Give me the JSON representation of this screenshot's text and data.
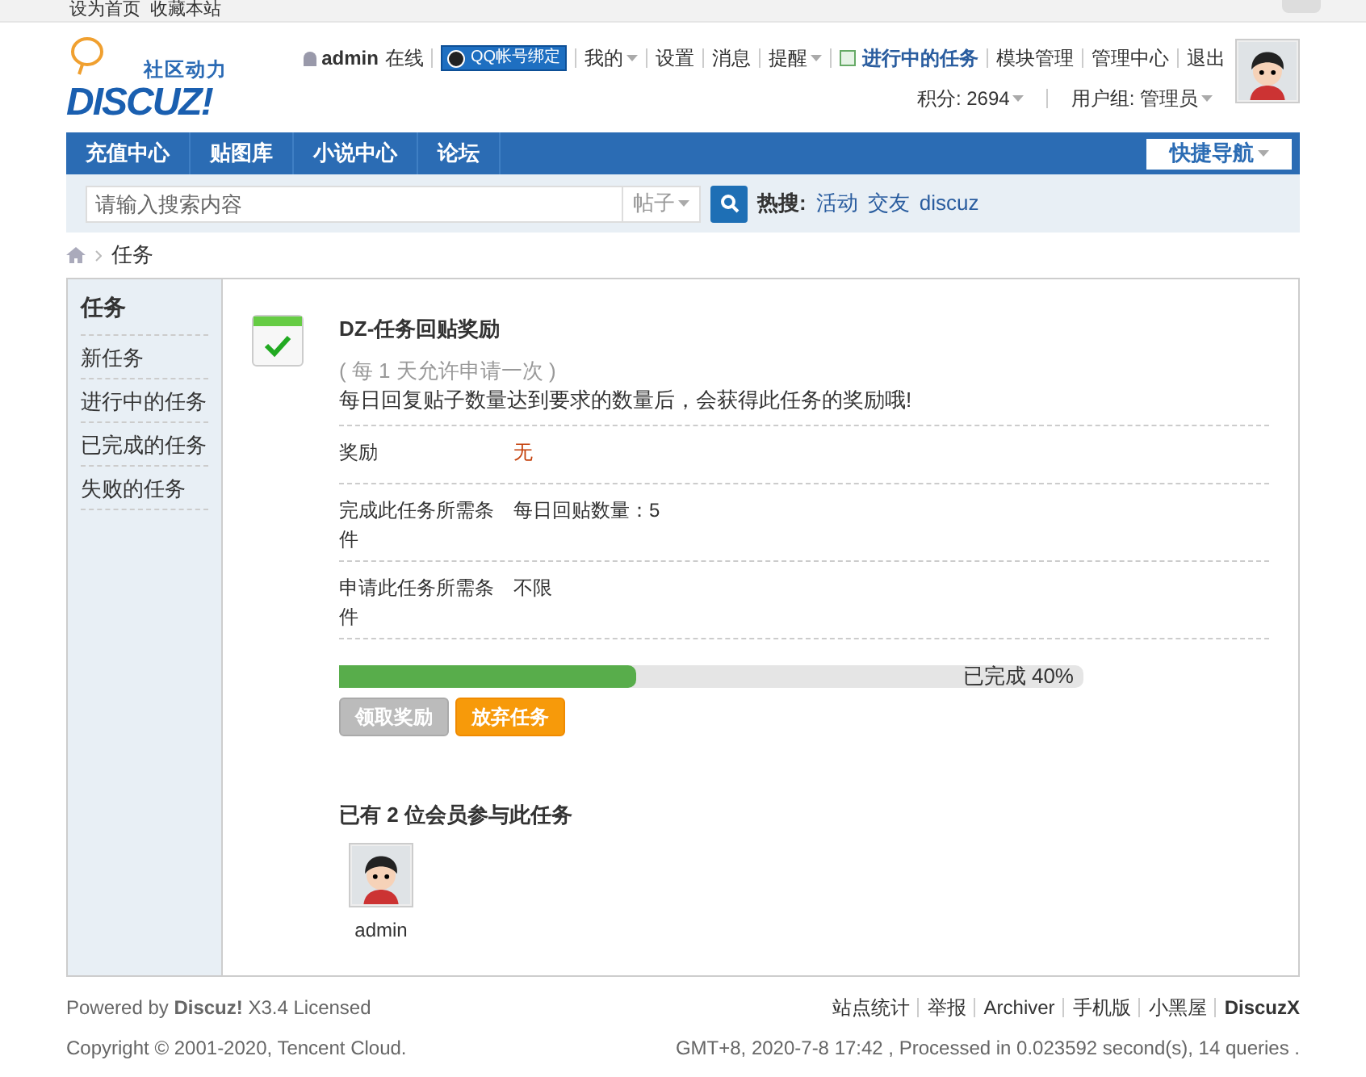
{
  "topbar": {
    "links": [
      "设为首页",
      "收藏本站"
    ]
  },
  "logo": {
    "slogan": "社区动力",
    "wordmark": "DISCUZ!"
  },
  "user_nav": {
    "username": "admin",
    "status": "在线",
    "qq_bind": "QQ帐号绑定",
    "links": [
      {
        "label": "我的",
        "has_menu": true,
        "kind": "link"
      },
      {
        "label": "设置",
        "has_menu": false,
        "kind": "link"
      },
      {
        "label": "消息",
        "has_menu": false,
        "kind": "link"
      },
      {
        "label": "提醒",
        "has_menu": true,
        "kind": "link"
      },
      {
        "label": "进行中的任务",
        "has_menu": false,
        "kind": "task"
      },
      {
        "label": "模块管理",
        "has_menu": false,
        "kind": "link"
      },
      {
        "label": "管理中心",
        "has_menu": false,
        "kind": "link"
      },
      {
        "label": "退出",
        "has_menu": false,
        "kind": "link"
      }
    ],
    "credits": "积分: 2694",
    "group": "用户组: 管理员"
  },
  "main_nav": {
    "items": [
      "充值中心",
      "贴图库",
      "小说中心",
      "论坛"
    ],
    "quick_nav": "快捷导航"
  },
  "search": {
    "placeholder": "请输入搜索内容",
    "scope": "帖子",
    "hot_label": "热搜:",
    "hot": [
      "活动",
      "交友",
      "discuz"
    ]
  },
  "breadcrumb": [
    "任务"
  ],
  "sidebar": {
    "title": "任务",
    "items": [
      {
        "label": "新任务",
        "selected": false
      },
      {
        "label": "进行中的任务",
        "selected": false
      },
      {
        "label": "已完成的任务",
        "selected": false
      },
      {
        "label": "失败的任务",
        "selected": false
      }
    ]
  },
  "task": {
    "title": "DZ-任务回贴奖励",
    "frequency": "( 每 1 天允许申请一次 )",
    "description": "每日回复贴子数量达到要求的数量后，会获得此任务的奖励哦!",
    "details": [
      {
        "label": "奖励",
        "value": "无",
        "kind": "reward"
      },
      {
        "label": "完成此任务所需条件",
        "value": "每日回贴数量：5",
        "kind": "plain"
      },
      {
        "label": "申请此任务所需条件",
        "value": "不限",
        "kind": "plain"
      }
    ],
    "progress": {
      "level": 0.4,
      "reading": "已完成 40%"
    },
    "buttons": [
      {
        "label": "领取奖励",
        "disabled": true
      },
      {
        "label": "放弃任务",
        "disabled": false
      }
    ],
    "participants_title": "已有 2 位会员参与此任务",
    "participants": [
      {
        "name": "admin"
      }
    ]
  },
  "footer": {
    "powered": "Powered by **Discuz!** X3.4 Licensed",
    "copyright": "Copyright © 2001-2020, Tencent Cloud.",
    "links": [
      {
        "label": "站点统计",
        "bold": false
      },
      {
        "label": "举报",
        "bold": false
      },
      {
        "label": "Archiver",
        "bold": false
      },
      {
        "label": "手机版",
        "bold": false
      },
      {
        "label": "小黑屋",
        "bold": false
      },
      {
        "label": "DiscuzX",
        "bold": true
      }
    ],
    "stats": "GMT+8, 2020-7-8 17:42 , Processed in 0.023592 second(s), 14 queries ."
  }
}
